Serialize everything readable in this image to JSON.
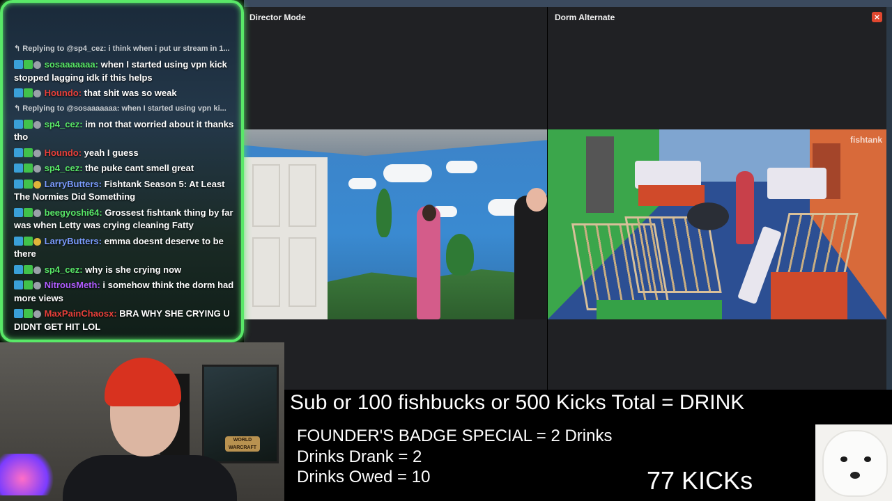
{
  "panels": {
    "left": {
      "title": "Director Mode"
    },
    "right": {
      "title": "Dorm Alternate",
      "close_label": "×",
      "watermark": "fishtank"
    }
  },
  "chat": {
    "messages": [
      {
        "type": "reply",
        "text": "Replying to @sp4_cez: i think when i put ur stream in 1..."
      },
      {
        "type": "msg",
        "user": "sosaaaaaaa:",
        "user_color": "green",
        "text": "when I started using vpn kick stopped lagging idk if this helps"
      },
      {
        "type": "msg",
        "user": "Houndo:",
        "user_color": "red",
        "text": "that shit was so weak"
      },
      {
        "type": "reply",
        "text": "Replying to @sosaaaaaaa: when I started using vpn ki..."
      },
      {
        "type": "msg",
        "user": "sp4_cez:",
        "user_color": "green",
        "text": "im not that worried about it thanks tho"
      },
      {
        "type": "msg",
        "user": "Houndo:",
        "user_color": "red",
        "text": "yeah I guess"
      },
      {
        "type": "msg",
        "user": "sp4_cez:",
        "user_color": "green",
        "text": "the puke cant smell great"
      },
      {
        "type": "msg",
        "user": "LarryButters:",
        "user_color": "blue",
        "text": "Fishtank Season 5: At Least The Normies Did Something"
      },
      {
        "type": "msg",
        "user": "beegyoshi64:",
        "user_color": "green",
        "text": "Grossest fishtank thing by far was when Letty was crying cleaning Fatty"
      },
      {
        "type": "msg",
        "user": "LarryButters:",
        "user_color": "blue",
        "text": "emma doesnt deserve to be there"
      },
      {
        "type": "msg",
        "user": "sp4_cez:",
        "user_color": "green",
        "text": "why is she crying now"
      },
      {
        "type": "msg",
        "user": "NitrousMeth:",
        "user_color": "purple",
        "text": "i somehow think the dorm had more views"
      },
      {
        "type": "msg",
        "user": "MaxPainChaosx:",
        "user_color": "red",
        "text": "BRA WHY SHE CRYING U DIDNT GET HIT LOL"
      }
    ]
  },
  "webcam": {
    "poster_text": "WORLD WARCRAFT"
  },
  "overlay": {
    "main": "Sub or 100 fishbucks or 500 Kicks Total = DRINK",
    "founders": "FOUNDER'S BADGE SPECIAL = 2 Drinks",
    "drank": "Drinks Drank = 2",
    "owed": "Drinks Owed = 10",
    "kicks": "77 KICKs"
  }
}
